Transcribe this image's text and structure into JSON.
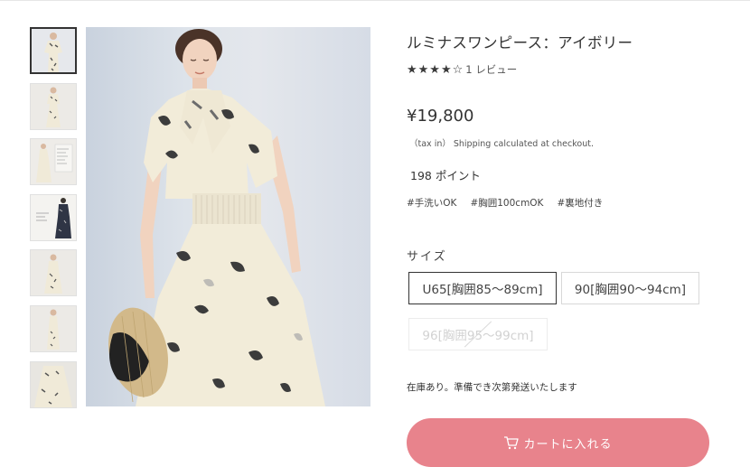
{
  "product": {
    "title": "ルミナスワンピース：アイボリー",
    "stars": "★★★★☆",
    "rating_count": "1 レビュー",
    "price": "¥19,800",
    "tax_note": "（tax in） Shipping calculated at checkout.",
    "points": "198 ポイント",
    "tags": [
      "#手洗いOK",
      "#胸囲100cmOK",
      "#裏地付き"
    ],
    "rating_value": 4
  },
  "size": {
    "label": "サイズ",
    "options": [
      {
        "label": "U65[胸囲85〜89cm]",
        "state": "selected"
      },
      {
        "label": "90[胸囲90〜94cm]",
        "state": "available"
      },
      {
        "label": "96[胸囲95〜99cm]",
        "state": "sold-out"
      }
    ]
  },
  "stock_text": "在庫あり。準備でき次第発送いたします",
  "cart_button": "カートに入れる",
  "gallery": {
    "thumbnail_count": 7,
    "active_index": 0
  },
  "colors": {
    "accent": "#e8838c",
    "text": "#333333",
    "border": "#d8d8d8"
  }
}
